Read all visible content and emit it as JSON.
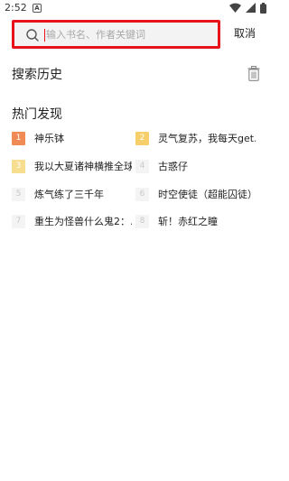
{
  "status_bar": {
    "time": "2:52",
    "notification_glyph": "A",
    "icons": [
      "wifi-icon",
      "signal-icon",
      "battery-icon"
    ]
  },
  "search": {
    "placeholder": "输入书名、作者关键词",
    "value": "",
    "cancel_label": "取消",
    "highlight_color": "#e8121b"
  },
  "history": {
    "title": "搜索历史",
    "clear_icon": "trash-icon"
  },
  "hot": {
    "title": "热门发现",
    "items": [
      {
        "rank": "1",
        "title": "神乐钵"
      },
      {
        "rank": "2",
        "title": "灵气复苏，我每天get…"
      },
      {
        "rank": "3",
        "title": "我以大夏诸神横推全球"
      },
      {
        "rank": "4",
        "title": "古惑仔"
      },
      {
        "rank": "5",
        "title": "炼气练了三千年"
      },
      {
        "rank": "6",
        "title": "时空使徒（超能囚徒）"
      },
      {
        "rank": "7",
        "title": "重生为怪兽什么鬼2：…"
      },
      {
        "rank": "8",
        "title": "斩！赤红之瞳"
      }
    ]
  }
}
